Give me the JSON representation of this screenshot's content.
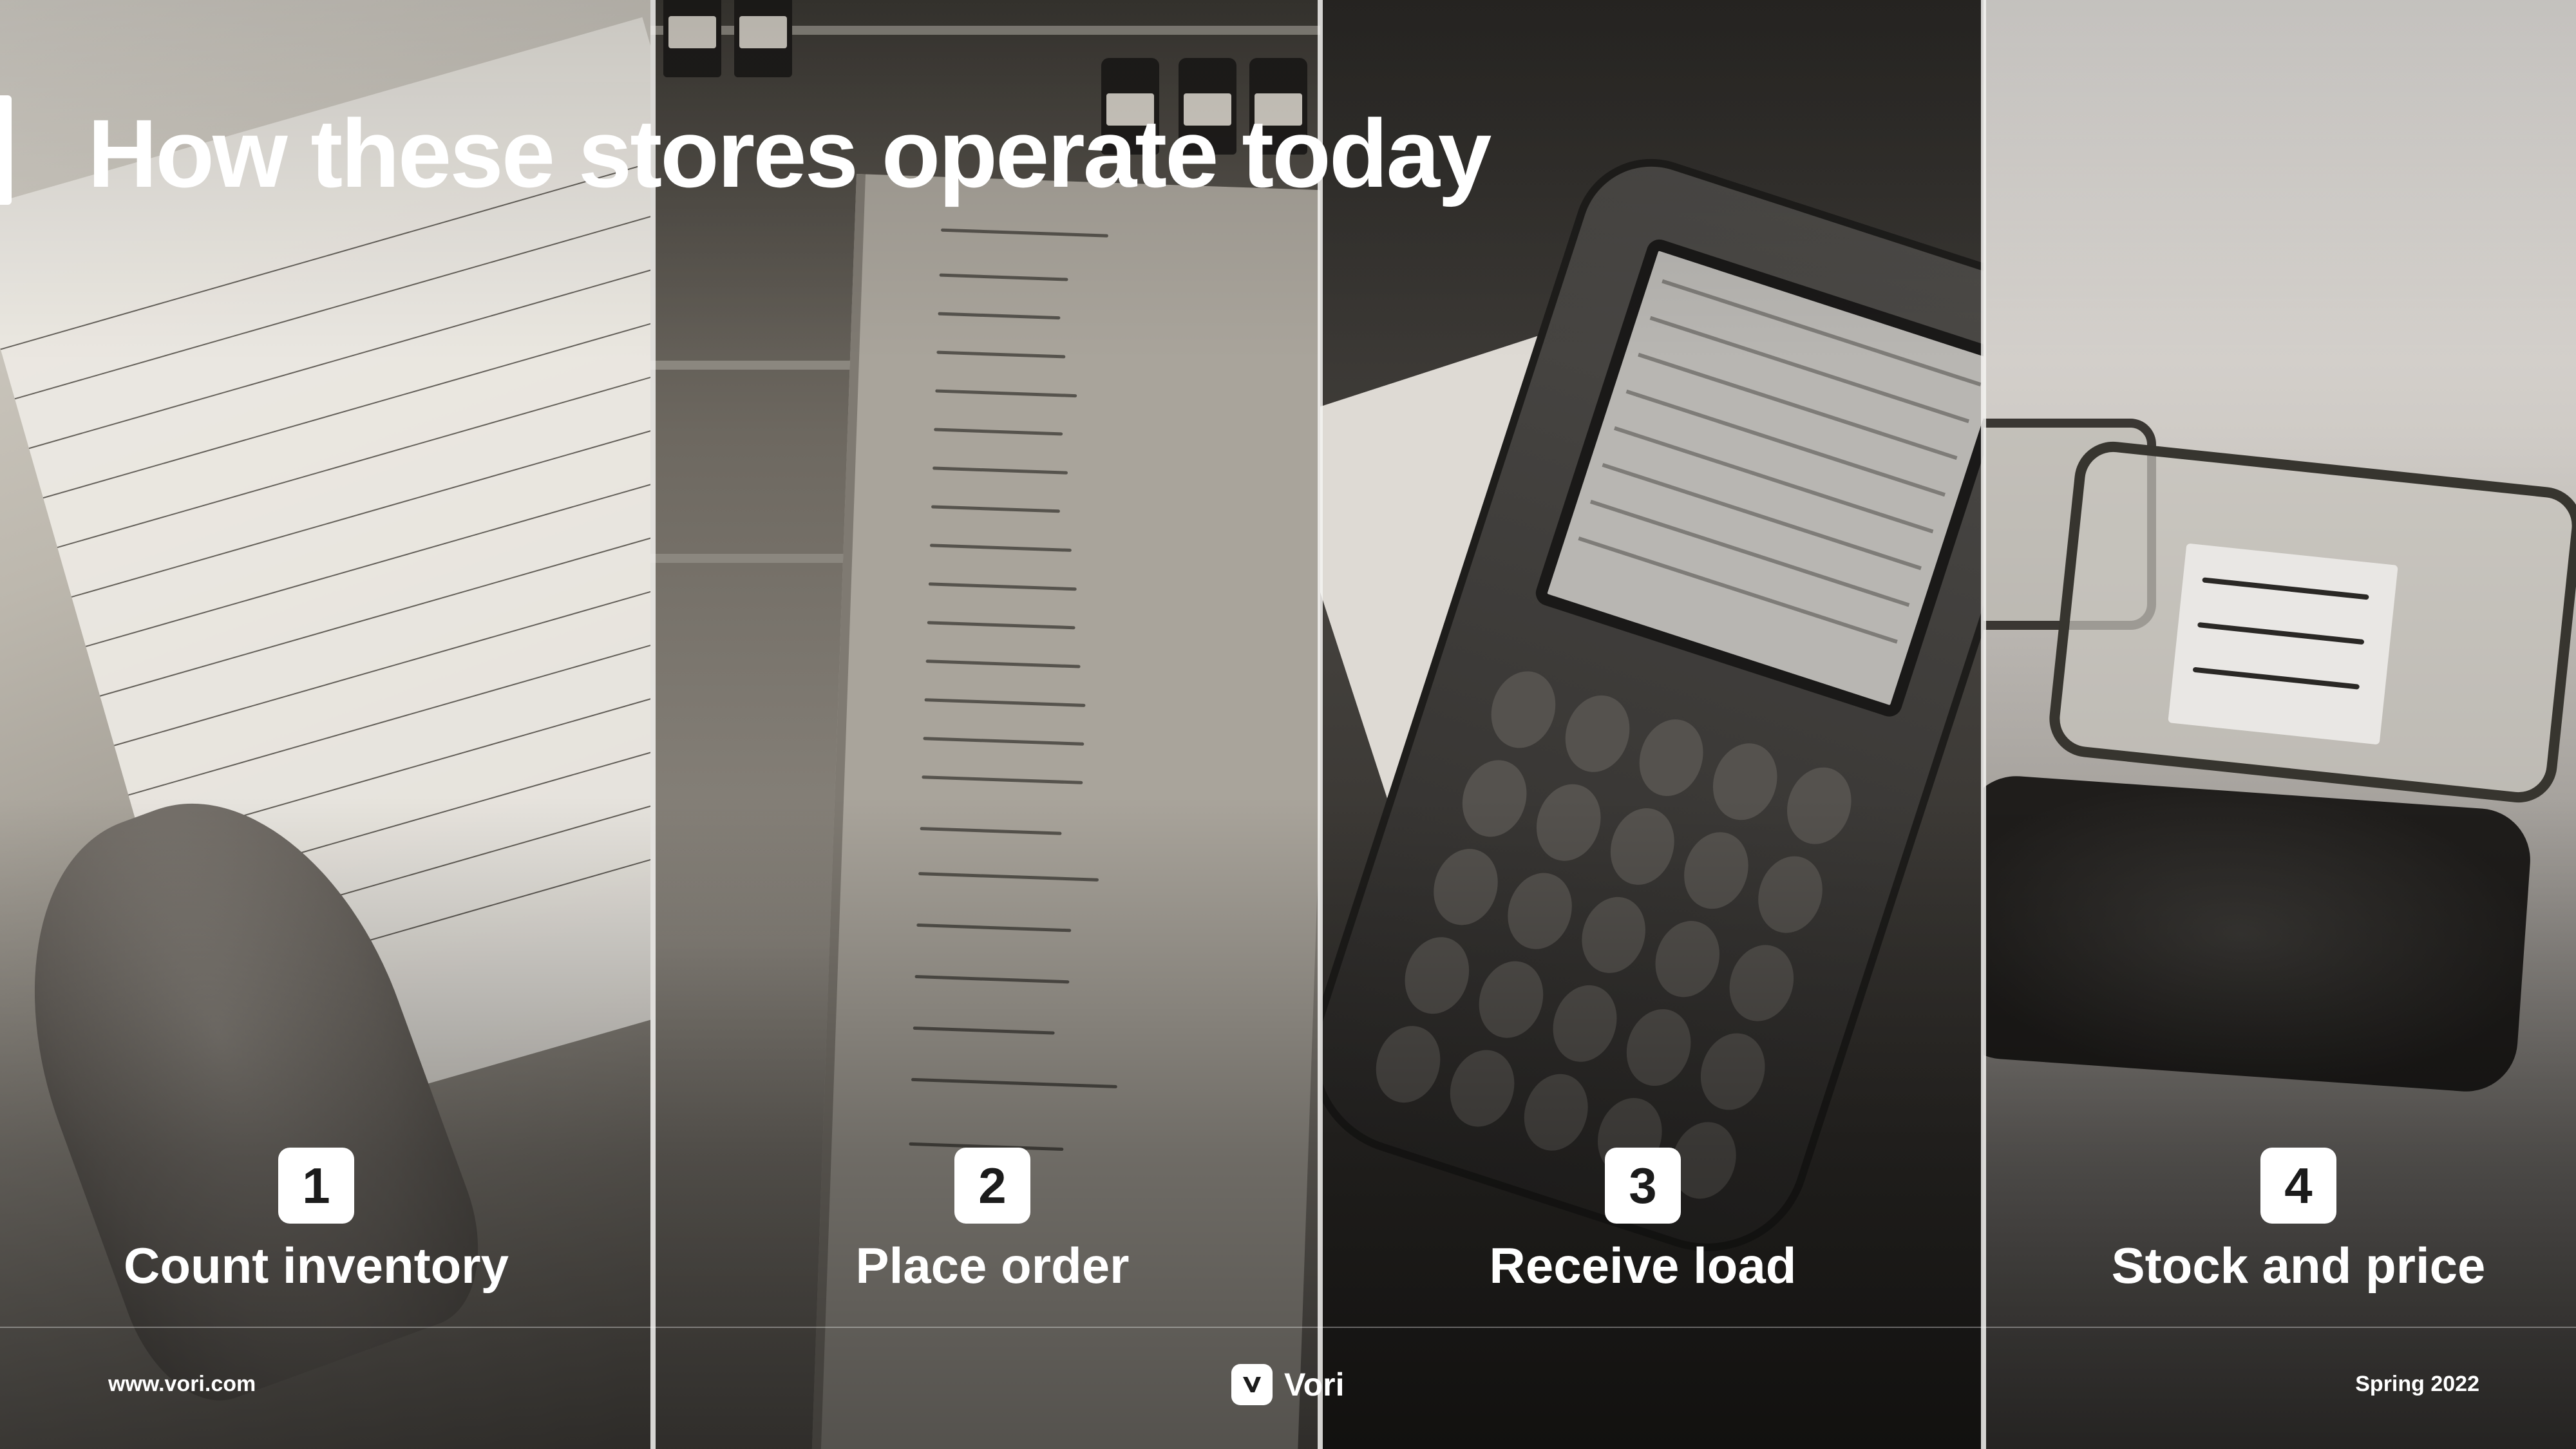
{
  "slide": {
    "title": "How these stores operate today"
  },
  "steps": [
    {
      "number": "1",
      "label": "Count inventory"
    },
    {
      "number": "2",
      "label": "Place order"
    },
    {
      "number": "3",
      "label": "Receive load"
    },
    {
      "number": "4",
      "label": "Stock and price"
    }
  ],
  "footer": {
    "website": "www.vori.com",
    "brand_name": "Vori",
    "date": "Spring 2022"
  },
  "colors": {
    "text": "#ffffff",
    "badge_bg": "#ffffff",
    "badge_text": "#1b1b1b"
  },
  "icons": {
    "brand_logo": "vori-logo-icon"
  }
}
